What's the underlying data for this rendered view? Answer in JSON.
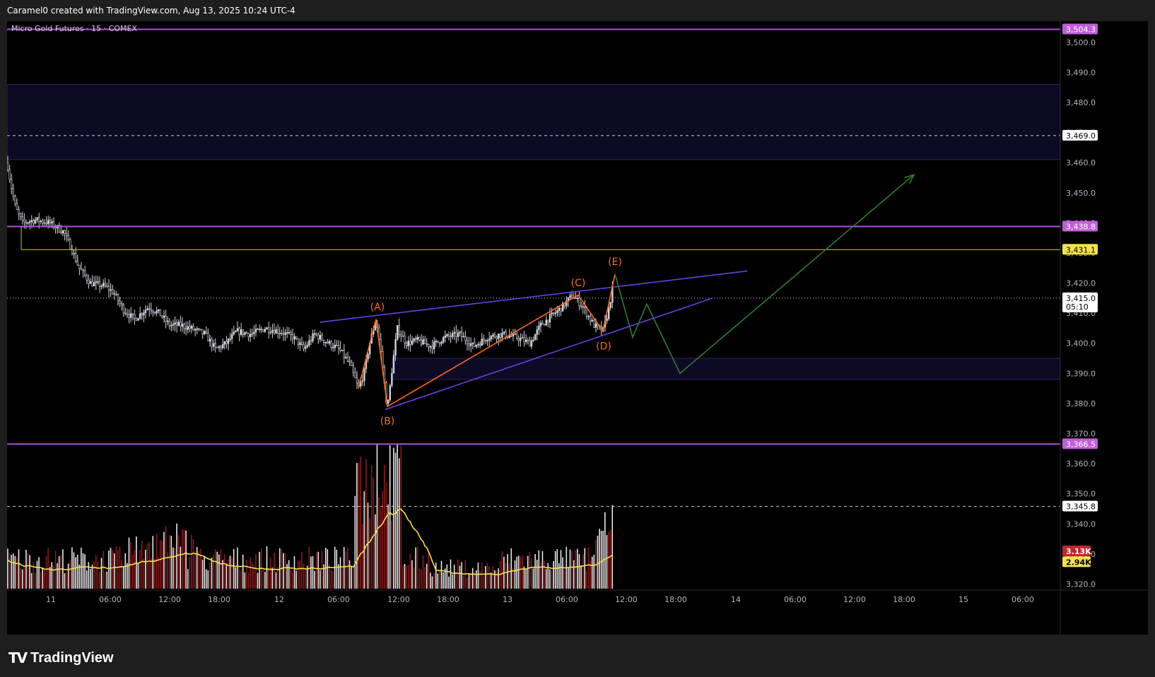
{
  "header": {
    "text": "Caramel0 created with TradingView.com, Aug 13, 2025 10:24 UTC-4"
  },
  "footer": {
    "brand": "TradingView",
    "logo": "TV"
  },
  "colors": {
    "background": "#000000",
    "outer": "#1e1e1e",
    "text": "#b2b5be",
    "candle": "#d1d4dc",
    "purple_line": "#b44fd8",
    "yellow_line": "#ddcc22",
    "trend": "#6a3fe0",
    "wave": "#ff6a1a",
    "projection": "#2e7d2e",
    "volume_up": "#e6e6e6",
    "volume_down": "#8b1a1a",
    "volume_ma": "#f5e24a",
    "zone": "#0d0a26",
    "zone_border": "#2d2560",
    "label_purple": "#c05ed8",
    "label_yellow": "#f5e24a",
    "label_red": "#c1272d"
  },
  "chart_data": {
    "type": "candlestick",
    "title": "Micro Gold Futures · 15 · COMEX",
    "ylim": [
      3318,
      3507
    ],
    "yticks": [
      "3,320.0",
      "3,330.0",
      "3,340.0",
      "3,350.0",
      "3,360.0",
      "3,370.0",
      "3,380.0",
      "3,390.0",
      "3,400.0",
      "3,410.0",
      "3,420.0",
      "3,430.0",
      "3,440.0",
      "3,450.0",
      "3,460.0",
      "3,470.0",
      "3,480.0",
      "3,490.0",
      "3,500.0"
    ],
    "xticks": [
      "11",
      "06:00",
      "12:00",
      "18:00",
      "12",
      "06:00",
      "12:00",
      "18:00",
      "13",
      "06:00",
      "12:00",
      "18:00",
      "14",
      "06:00",
      "12:00",
      "18:00",
      "15",
      "06:00"
    ],
    "price_path": [
      [
        0,
        3460
      ],
      [
        6,
        3452
      ],
      [
        12,
        3445
      ],
      [
        22,
        3440
      ],
      [
        40,
        3441
      ],
      [
        60,
        3440
      ],
      [
        80,
        3437
      ],
      [
        90,
        3432
      ],
      [
        102,
        3425
      ],
      [
        118,
        3420
      ],
      [
        138,
        3419
      ],
      [
        150,
        3417
      ],
      [
        165,
        3411
      ],
      [
        180,
        3408
      ],
      [
        200,
        3412
      ],
      [
        215,
        3410
      ],
      [
        230,
        3406
      ],
      [
        245,
        3406
      ],
      [
        260,
        3405
      ],
      [
        280,
        3403
      ],
      [
        295,
        3398
      ],
      [
        310,
        3400
      ],
      [
        325,
        3404
      ],
      [
        345,
        3403
      ],
      [
        365,
        3405
      ],
      [
        385,
        3404
      ],
      [
        405,
        3402
      ],
      [
        420,
        3398
      ],
      [
        435,
        3403
      ],
      [
        455,
        3400
      ],
      [
        470,
        3398
      ],
      [
        485,
        3393
      ],
      [
        497,
        3385
      ],
      [
        505,
        3390
      ],
      [
        513,
        3400
      ],
      [
        522,
        3408
      ],
      [
        530,
        3395
      ],
      [
        538,
        3378
      ],
      [
        545,
        3392
      ],
      [
        552,
        3405
      ],
      [
        565,
        3400
      ],
      [
        580,
        3401
      ],
      [
        600,
        3399
      ],
      [
        620,
        3402
      ],
      [
        640,
        3403
      ],
      [
        660,
        3399
      ],
      [
        680,
        3402
      ],
      [
        700,
        3403
      ],
      [
        720,
        3402
      ],
      [
        740,
        3400
      ],
      [
        755,
        3406
      ],
      [
        770,
        3409
      ],
      [
        785,
        3412
      ],
      [
        800,
        3416
      ],
      [
        815,
        3412
      ],
      [
        830,
        3406
      ],
      [
        843,
        3404
      ],
      [
        852,
        3412
      ],
      [
        860,
        3423
      ]
    ],
    "horizontal_lines": [
      {
        "price": 3504.3,
        "label": "3,504.3",
        "style": "solid",
        "color": "purple"
      },
      {
        "price": 3469.0,
        "label": "3,469.0",
        "style": "dashed",
        "color": "white"
      },
      {
        "price": 3438.8,
        "label": "3,438.8",
        "style": "solid",
        "color": "purple"
      },
      {
        "price": 3431.1,
        "label": "3,431.1",
        "style": "solid",
        "color": "yellow"
      },
      {
        "price": 3415.0,
        "label": "3,415.0",
        "style": "dotted",
        "color": "white",
        "countdown": "05:10"
      },
      {
        "price": 3366.5,
        "label": "3,366.5",
        "style": "solid",
        "color": "purple"
      },
      {
        "price": 3345.8,
        "label": "3,345.8",
        "style": "dashed",
        "color": "white"
      }
    ],
    "zones": [
      {
        "from": 3461,
        "to": 3486
      },
      {
        "from": 3388,
        "to": 3395
      }
    ],
    "trendlines": [
      [
        [
          443,
          3407
        ],
        [
          1047,
          3424
        ]
      ],
      [
        [
          535,
          3378
        ],
        [
          998,
          3415
        ]
      ]
    ],
    "wave_path": [
      [
        497,
        3385
      ],
      [
        522,
        3408
      ],
      [
        538,
        3379
      ],
      [
        808,
        3416
      ],
      [
        843,
        3404
      ],
      [
        860,
        3423
      ]
    ],
    "wave_labels": [
      {
        "text": "(A)",
        "x": 524,
        "y": 3411
      },
      {
        "text": "(B)",
        "x": 538,
        "y": 3373
      },
      {
        "text": "(C)",
        "x": 808,
        "y": 3419
      },
      {
        "text": "(D)",
        "x": 844,
        "y": 3398
      },
      {
        "text": "(E)",
        "x": 860,
        "y": 3426
      }
    ],
    "projection_path": [
      [
        860,
        3423
      ],
      [
        885,
        3402
      ],
      [
        905,
        3413
      ],
      [
        952,
        3390
      ],
      [
        1283,
        3456
      ]
    ],
    "volume": {
      "up_color_value": "white",
      "labels": [
        {
          "text": "3.13K",
          "price": 3330.9,
          "color": "red"
        },
        {
          "text": "2.94K",
          "price": 3327.3,
          "color": "yellow"
        }
      ]
    }
  }
}
